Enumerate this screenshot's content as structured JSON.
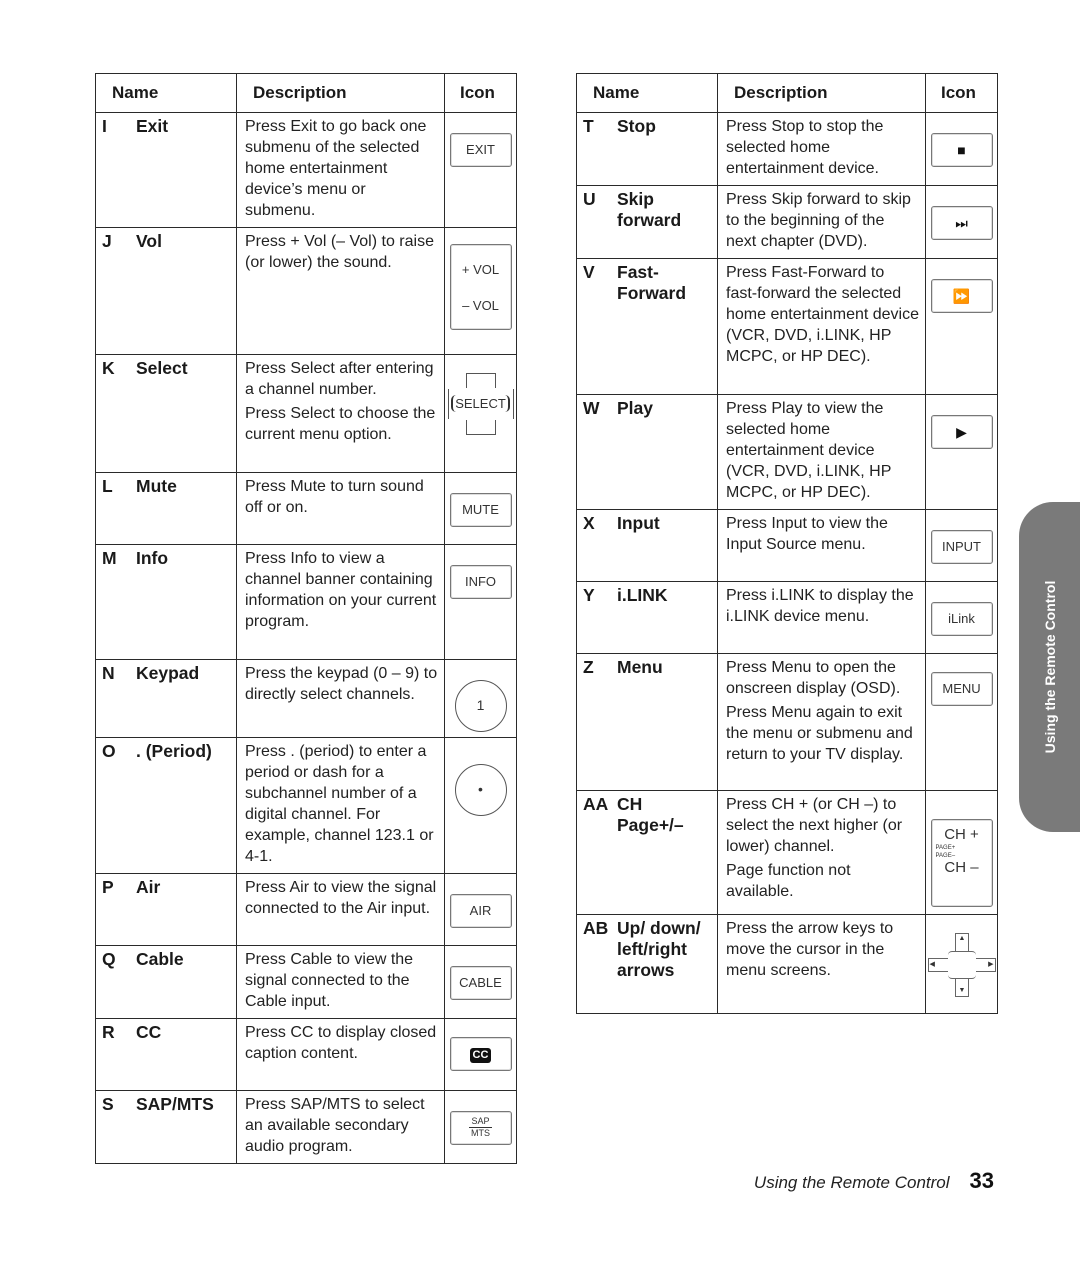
{
  "headers": {
    "name": "Name",
    "description": "Description",
    "icon": "Icon"
  },
  "left_rows": [
    {
      "letter": "I",
      "name": "Exit",
      "desc": [
        "Press Exit to go back one submenu of the selected home entertainment device’s menu or submenu."
      ],
      "icon": {
        "type": "button",
        "semantic": "exit-button-icon",
        "label": "EXIT"
      }
    },
    {
      "letter": "J",
      "name": "Vol",
      "desc": [
        "Press + Vol (– Vol) to raise (or lower) the sound."
      ],
      "icon": {
        "type": "volume",
        "semantic": "volume-button-icon",
        "labels": [
          "+ VOL",
          "– VOL"
        ]
      }
    },
    {
      "letter": "K",
      "name": "Select",
      "desc": [
        "Press Select after entering a channel number.",
        "Press Select to choose the current menu option."
      ],
      "icon": {
        "type": "select",
        "semantic": "select-button-icon",
        "label": "SELECT"
      }
    },
    {
      "letter": "L",
      "name": "Mute",
      "desc": [
        "Press Mute to turn sound off or on."
      ],
      "icon": {
        "type": "button",
        "semantic": "mute-button-icon",
        "label": "MUTE"
      }
    },
    {
      "letter": "M",
      "name": "Info",
      "desc": [
        "Press Info to view a channel banner containing information on your current program."
      ],
      "icon": {
        "type": "button",
        "semantic": "info-button-icon",
        "label": "INFO"
      }
    },
    {
      "letter": "N",
      "name": "Keypad",
      "desc": [
        "Press the keypad (0 – 9) to directly select channels."
      ],
      "icon": {
        "type": "circle",
        "semantic": "keypad-button-icon",
        "label": "1"
      }
    },
    {
      "letter": "O",
      "name": ". (Period)",
      "desc": [
        "Press . (period) to enter a period or dash for a subchannel number of a digital channel. For example, channel 123.1 or 4-1."
      ],
      "icon": {
        "type": "circle",
        "semantic": "period-button-icon",
        "label": "•"
      }
    },
    {
      "letter": "P",
      "name": "Air",
      "desc": [
        "Press Air to view the signal connected to the Air input."
      ],
      "icon": {
        "type": "button",
        "semantic": "air-button-icon",
        "label": "AIR"
      }
    },
    {
      "letter": "Q",
      "name": "Cable",
      "desc": [
        "Press Cable to view the signal connected to the Cable input."
      ],
      "icon": {
        "type": "button",
        "semantic": "cable-button-icon",
        "label": "CABLE"
      }
    },
    {
      "letter": "R",
      "name": "CC",
      "desc": [
        "Press CC to display closed caption content."
      ],
      "icon": {
        "type": "cc",
        "semantic": "closed-caption-button-icon",
        "label": "CC"
      }
    },
    {
      "letter": "S",
      "name": "SAP/MTS",
      "desc": [
        "Press SAP/MTS to select an available secondary audio program."
      ],
      "icon": {
        "type": "sapmts",
        "semantic": "sap-mts-button-icon",
        "labels": [
          "SAP",
          "MTS"
        ]
      }
    }
  ],
  "right_rows": [
    {
      "letter": "T",
      "name": "Stop",
      "desc": [
        "Press Stop to stop the selected home entertainment device."
      ],
      "icon": {
        "type": "glyph",
        "semantic": "stop-button-icon",
        "label": "■"
      }
    },
    {
      "letter": "U",
      "name": "Skip forward",
      "desc": [
        "Press Skip forward to skip to the beginning of the next chapter (DVD)."
      ],
      "icon": {
        "type": "glyph",
        "semantic": "skip-forward-button-icon",
        "label": "⏭"
      }
    },
    {
      "letter": "V",
      "name": "Fast-Forward",
      "desc": [
        "Press Fast-Forward to fast-forward the selected home entertainment device (VCR, DVD, i.LINK, HP MCPC, or HP DEC)."
      ],
      "icon": {
        "type": "glyph",
        "semantic": "fast-forward-button-icon",
        "label": "⏩"
      }
    },
    {
      "letter": "W",
      "name": "Play",
      "desc": [
        "Press Play to view the selected home entertainment device (VCR, DVD, i.LINK, HP MCPC, or HP DEC)."
      ],
      "icon": {
        "type": "glyph",
        "semantic": "play-button-icon",
        "label": "▶"
      }
    },
    {
      "letter": "X",
      "name": "Input",
      "desc": [
        "Press Input to view the Input Source menu."
      ],
      "icon": {
        "type": "button",
        "semantic": "input-button-icon",
        "label": "INPUT"
      }
    },
    {
      "letter": "Y",
      "name": "i.LINK",
      "desc": [
        "Press i.LINK to display the i.LINK device menu."
      ],
      "icon": {
        "type": "button",
        "semantic": "ilink-button-icon",
        "label": "iLink"
      }
    },
    {
      "letter": "Z",
      "name": "Menu",
      "desc": [
        "Press Menu to open the onscreen display (OSD).",
        "Press Menu again to exit the menu or submenu and return to your TV display."
      ],
      "icon": {
        "type": "button",
        "semantic": "menu-button-icon",
        "label": "MENU"
      }
    },
    {
      "letter": "AA",
      "name": "CH Page+/–",
      "desc": [
        "Press CH + (or CH –) to select the next higher (or lower) channel.",
        "Page function not available."
      ],
      "icon": {
        "type": "ch",
        "semantic": "channel-page-button-icon",
        "labels": [
          "CH +",
          "PAGE+",
          "PAGE–",
          "CH –"
        ]
      }
    },
    {
      "letter": "AB",
      "name": "Up/ down/ left/right arrows",
      "desc": [
        "Press the arrow keys to move the cursor in the menu screens."
      ],
      "icon": {
        "type": "arrows",
        "semantic": "arrow-keys-icon",
        "labels": [
          "▲",
          "▼",
          "◀",
          "▶"
        ]
      }
    }
  ],
  "side_tab": "Using the Remote Control",
  "footer": {
    "title": "Using the Remote Control",
    "page_number": "33"
  }
}
